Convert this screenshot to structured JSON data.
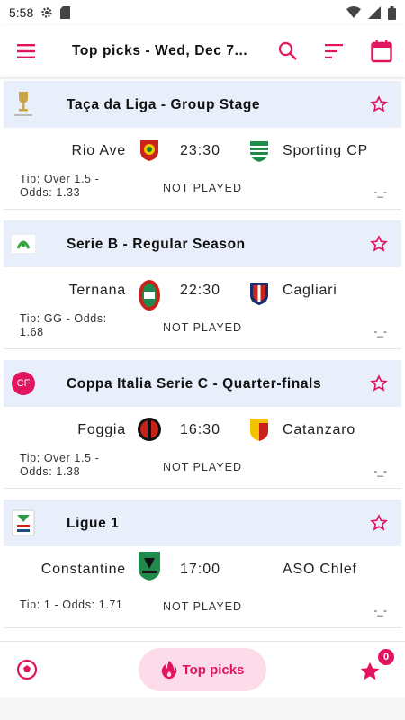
{
  "status_bar": {
    "time": "5:58"
  },
  "app_bar": {
    "title": "Top picks - Wed, Dec 7..."
  },
  "colors": {
    "accent": "#e2145f",
    "league_header_bg": "#e8eefa"
  },
  "leagues": [
    {
      "name": "Taça da Liga - Group Stage",
      "logo_icon": "taca-da-liga-logo",
      "match": {
        "home": "Rio Ave",
        "time": "23:30",
        "away": "Sporting CP",
        "tip": "Tip: Over 1.5 - Odds: 1.33",
        "status": "NOT PLAYED",
        "result": "-_-"
      }
    },
    {
      "name": "Serie B - Regular Season",
      "logo_icon": "serie-b-logo",
      "match": {
        "home": "Ternana",
        "time": "22:30",
        "away": "Cagliari",
        "tip": "Tip: GG - Odds: 1.68",
        "status": "NOT PLAYED",
        "result": "-_-"
      }
    },
    {
      "name": "Coppa Italia Serie C - Quarter-finals",
      "logo_icon": "coppa-italia-c-logo",
      "logo_text": "CF",
      "match": {
        "home": "Foggia",
        "time": "16:30",
        "away": "Catanzaro",
        "tip": "Tip: Over 1.5 - Odds: 1.38",
        "status": "NOT PLAYED",
        "result": "-_-"
      }
    },
    {
      "name": "Ligue 1",
      "logo_icon": "ligue-1-logo",
      "match": {
        "home": "Constantine",
        "time": "17:00",
        "away": "ASO Chlef",
        "tip": "Tip: 1 - Odds: 1.71",
        "status": "NOT PLAYED",
        "result": "-_-"
      }
    }
  ],
  "bottom_nav": {
    "top_picks_label": "Top picks",
    "favorites_count": "0"
  }
}
